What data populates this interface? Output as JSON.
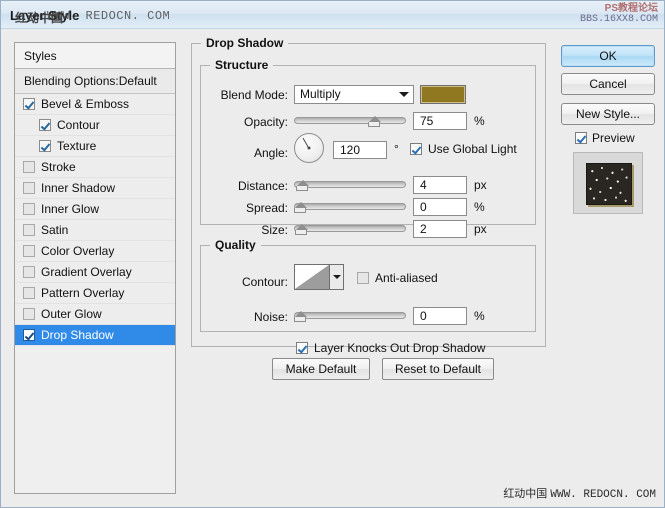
{
  "window": {
    "title": "Layer Style",
    "watermark_title_cn": "红动中国",
    "watermark_title_url": "WWW. REDOCN. COM",
    "watermark_topright_line1": "PS教程论坛",
    "watermark_topright_line2": "BBS.16XX8.COM",
    "watermark_bottom_cn": "红动中国",
    "watermark_bottom_url": "WWW. REDOCN. COM"
  },
  "styles_panel": {
    "header": "Styles",
    "blending_options": "Blending Options:Default",
    "effects": [
      {
        "label": "Bevel & Emboss",
        "checked": true,
        "sub": false,
        "selected": false
      },
      {
        "label": "Contour",
        "checked": true,
        "sub": true,
        "selected": false
      },
      {
        "label": "Texture",
        "checked": true,
        "sub": true,
        "selected": false
      },
      {
        "label": "Stroke",
        "checked": false,
        "sub": false,
        "selected": false
      },
      {
        "label": "Inner Shadow",
        "checked": false,
        "sub": false,
        "selected": false
      },
      {
        "label": "Inner Glow",
        "checked": false,
        "sub": false,
        "selected": false
      },
      {
        "label": "Satin",
        "checked": false,
        "sub": false,
        "selected": false
      },
      {
        "label": "Color Overlay",
        "checked": false,
        "sub": false,
        "selected": false
      },
      {
        "label": "Gradient Overlay",
        "checked": false,
        "sub": false,
        "selected": false
      },
      {
        "label": "Pattern Overlay",
        "checked": false,
        "sub": false,
        "selected": false
      },
      {
        "label": "Outer Glow",
        "checked": false,
        "sub": false,
        "selected": false
      },
      {
        "label": "Drop Shadow",
        "checked": true,
        "sub": false,
        "selected": true
      }
    ]
  },
  "drop_shadow": {
    "title": "Drop Shadow",
    "structure": {
      "title": "Structure",
      "blend_mode_label": "Blend Mode:",
      "blend_mode_value": "Multiply",
      "shadow_color": "#8f7820",
      "opacity_label": "Opacity:",
      "opacity_value": "75",
      "opacity_unit": "%",
      "opacity_percent": 75,
      "angle_label": "Angle:",
      "angle_value": "120",
      "angle_unit": "°",
      "angle_degrees": 120,
      "use_global_light_label": "Use Global Light",
      "use_global_light_checked": true,
      "distance_label": "Distance:",
      "distance_value": "4",
      "distance_unit": "px",
      "distance_percent": 2,
      "spread_label": "Spread:",
      "spread_value": "0",
      "spread_unit": "%",
      "spread_percent": 0,
      "size_label": "Size:",
      "size_value": "2",
      "size_unit": "px",
      "size_percent": 1
    },
    "quality": {
      "title": "Quality",
      "contour_label": "Contour:",
      "anti_aliased_label": "Anti-aliased",
      "anti_aliased_checked": false,
      "noise_label": "Noise:",
      "noise_value": "0",
      "noise_unit": "%",
      "noise_percent": 0
    },
    "knockout_label": "Layer Knocks Out Drop Shadow",
    "knockout_checked": true,
    "make_default_label": "Make Default",
    "reset_default_label": "Reset to Default"
  },
  "actions": {
    "ok_label": "OK",
    "cancel_label": "Cancel",
    "new_style_label": "New Style...",
    "preview_label": "Preview",
    "preview_checked": true
  }
}
